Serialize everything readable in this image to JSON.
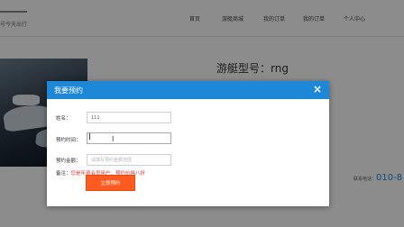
{
  "header": {
    "slogan": "号今天出行",
    "nav": [
      "首页",
      "游艇商城",
      "我的订单",
      "我的订单",
      "个人中心"
    ]
  },
  "main": {
    "title": "游艇型号：rng",
    "contact_label": "联系电话：",
    "contact_phone": "010-8"
  },
  "modal": {
    "title": "我要预约",
    "close_icon": "×",
    "fields": {
      "name_label": "姓名：",
      "name_value": "111",
      "time_label": "预约时间：",
      "time_value": "",
      "amount_label": "预约金额：",
      "amount_placeholder": "请填写预约金额范围"
    },
    "note_prefix": "备注：",
    "note_highlight": "您是年费会员用户，预约价格八折",
    "submit_label": "立即预约"
  },
  "colors": {
    "primary": "#1e88d8",
    "submit": "#ff5a1f",
    "note": "#e53935"
  }
}
